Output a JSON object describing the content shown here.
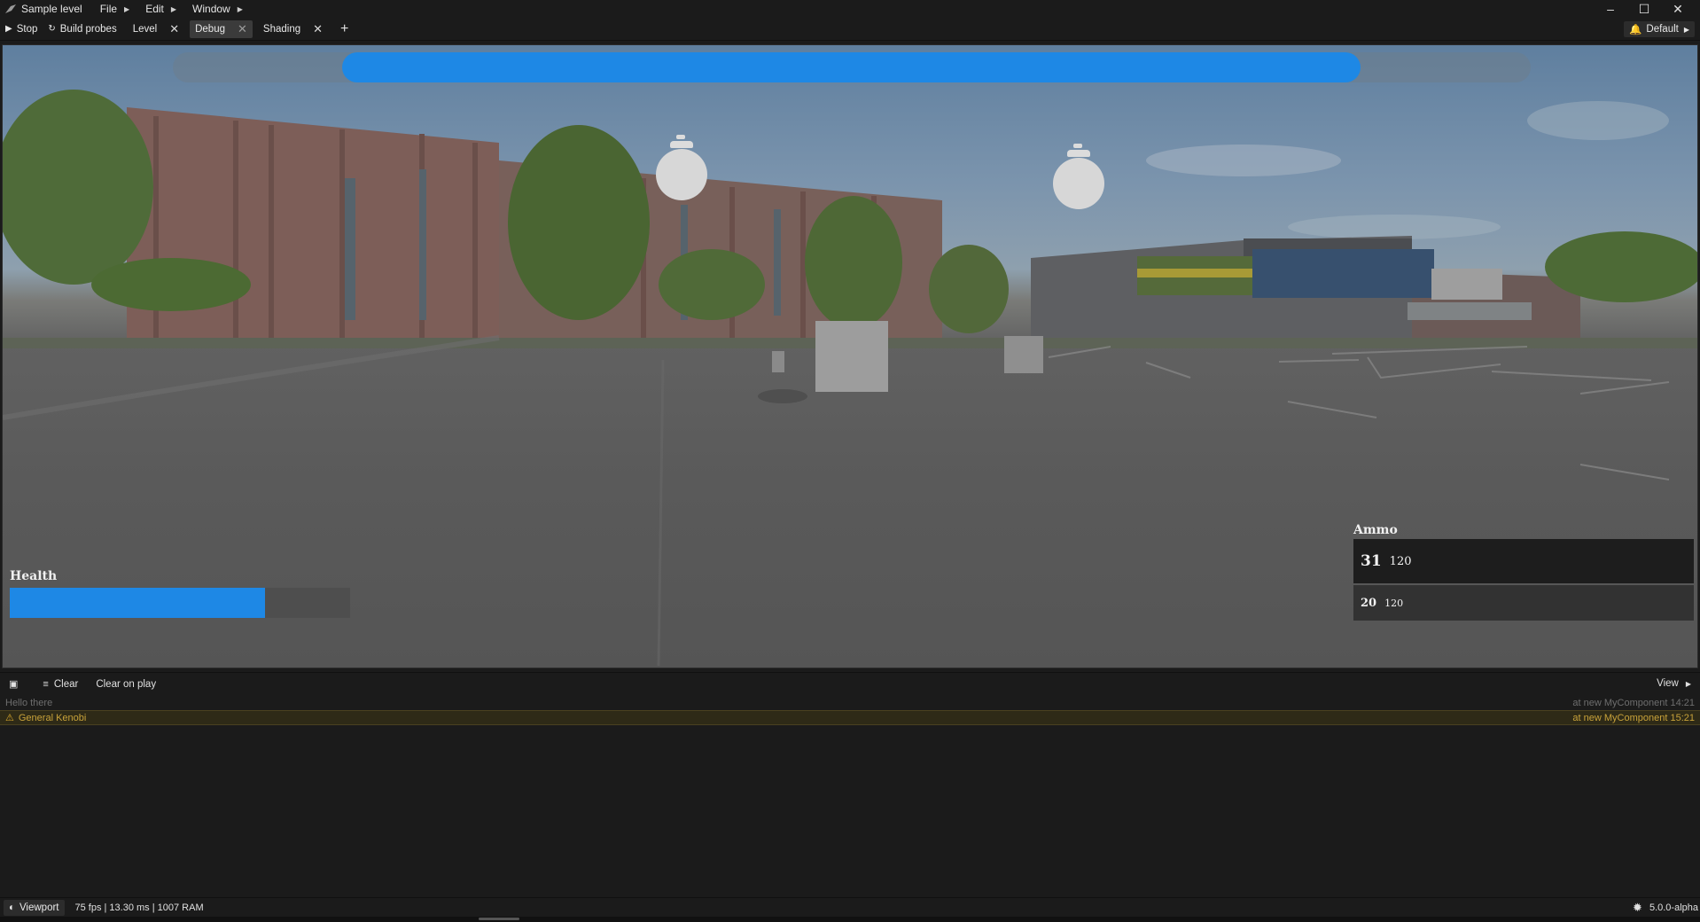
{
  "window": {
    "title": "Sample level",
    "menu": [
      "File",
      "Edit",
      "Window"
    ],
    "controls": {
      "minimize": "–",
      "maximize": "☐",
      "close": "✕"
    }
  },
  "toolbar": {
    "stop_label": "Stop",
    "build_probes_label": "Build probes",
    "tabs": [
      {
        "label": "Level",
        "active": false
      },
      {
        "label": "Debug",
        "active": true
      },
      {
        "label": "Shading",
        "active": false
      }
    ],
    "add_tab": "+",
    "layout_label": "Default"
  },
  "viewport": {
    "top_progress": 0.75,
    "hud": {
      "health_label": "Health",
      "health_fraction": 0.75,
      "ammo_label": "Ammo",
      "ammo": [
        {
          "current": "31",
          "reserve": "120"
        },
        {
          "current": "20",
          "reserve": "120"
        }
      ]
    }
  },
  "console": {
    "clear_label": "Clear",
    "clear_on_play_label": "Clear on play",
    "view_label": "View",
    "logs": [
      {
        "level": "info",
        "message": "Hello there",
        "source": "at new MyComponent 14:21"
      },
      {
        "level": "warning",
        "message": "General Kenobi",
        "source": "at new MyComponent 15:21"
      }
    ]
  },
  "status": {
    "viewport_label": "Viewport",
    "stats": "75 fps | 13.30 ms | 1007 RAM",
    "version": "5.0.0-alpha"
  },
  "colors": {
    "accent": "#1e88e5",
    "warning": "#c8a23a"
  }
}
